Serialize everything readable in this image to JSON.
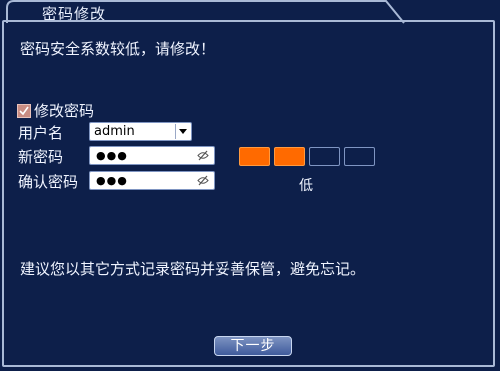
{
  "dialog": {
    "title": "密码修改",
    "warning": "密码安全系数较低，请修改！",
    "modify_checkbox": {
      "label": "修改密码",
      "checked": true
    },
    "username": {
      "label": "用户名",
      "value": "admin"
    },
    "new_password": {
      "label": "新密码",
      "masked": "●●●"
    },
    "confirm_password": {
      "label": "确认密码",
      "masked": "●●●"
    },
    "strength": {
      "level": 2,
      "total": 4,
      "label": "低",
      "color": "#ff6a00"
    },
    "advice": "建议您以其它方式记录密码并妥善保管，避免忘记。",
    "next_button": "下一步"
  }
}
